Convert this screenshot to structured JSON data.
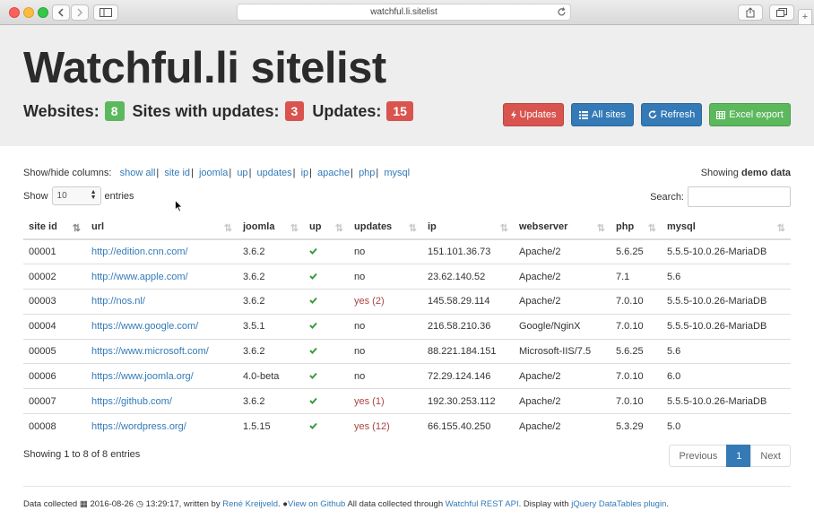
{
  "browser": {
    "url": "watchful.li.sitelist"
  },
  "header": {
    "title": "Watchful.li sitelist",
    "websites_label": "Websites:",
    "websites_count": "8",
    "sites_updates_label": "Sites with updates:",
    "sites_updates_count": "3",
    "updates_label": "Updates:",
    "updates_count": "15",
    "buttons": {
      "updates": "Updates",
      "all_sites": "All sites",
      "refresh": "Refresh",
      "excel": "Excel export"
    }
  },
  "columns_toggle": {
    "label": "Show/hide columns:",
    "links": [
      "show all",
      "site id",
      "joomla",
      "up",
      "updates",
      "ip",
      "apache",
      "php",
      "mysql"
    ]
  },
  "demo": {
    "prefix": "Showing",
    "bold": "demo data"
  },
  "length": {
    "show": "Show",
    "value": "10",
    "entries": "entries"
  },
  "search": {
    "label": "Search:"
  },
  "table": {
    "headers": [
      "site id",
      "url",
      "joomla",
      "up",
      "updates",
      "ip",
      "webserver",
      "php",
      "mysql"
    ],
    "rows": [
      [
        "00001",
        "http://edition.cnn.com/",
        "3.6.2",
        "no",
        "151.101.36.73",
        "Apache/2",
        "5.6.25",
        "5.5.5-10.0.26-MariaDB"
      ],
      [
        "00002",
        "http://www.apple.com/",
        "3.6.2",
        "no",
        "23.62.140.52",
        "Apache/2",
        "7.1",
        "5.6"
      ],
      [
        "00003",
        "http://nos.nl/",
        "3.6.2",
        "yes (2)",
        "145.58.29.114",
        "Apache/2",
        "7.0.10",
        "5.5.5-10.0.26-MariaDB"
      ],
      [
        "00004",
        "https://www.google.com/",
        "3.5.1",
        "no",
        "216.58.210.36",
        "Google/NginX",
        "7.0.10",
        "5.5.5-10.0.26-MariaDB"
      ],
      [
        "00005",
        "https://www.microsoft.com/",
        "3.6.2",
        "no",
        "88.221.184.151",
        "Microsoft-IIS/7.5",
        "5.6.25",
        "5.6"
      ],
      [
        "00006",
        "https://www.joomla.org/",
        "4.0-beta",
        "no",
        "72.29.124.146",
        "Apache/2",
        "7.0.10",
        "6.0"
      ],
      [
        "00007",
        "https://github.com/",
        "3.6.2",
        "yes (1)",
        "192.30.253.112",
        "Apache/2",
        "7.0.10",
        "5.5.5-10.0.26-MariaDB"
      ],
      [
        "00008",
        "https://wordpress.org/",
        "1.5.15",
        "yes (12)",
        "66.155.40.250",
        "Apache/2",
        "5.3.29",
        "5.0"
      ]
    ]
  },
  "info": "Showing 1 to 8 of 8 entries",
  "pager": {
    "previous": "Previous",
    "current": "1",
    "next": "Next"
  },
  "footer": {
    "t1": "Data collected",
    "date": "2016-08-26",
    "time": "13:29:17, written by",
    "author": "René Kreijveld",
    "github": "View on Github",
    "t2": "All data collected through",
    "api": "Watchful REST API",
    "t3": ". Display with",
    "plugin": "jQuery DataTables plugin",
    "t4": "."
  },
  "colors": {
    "blue": "#337ab7",
    "red": "#d9534f",
    "green": "#5cb85c",
    "update_yes": "#a94442"
  }
}
